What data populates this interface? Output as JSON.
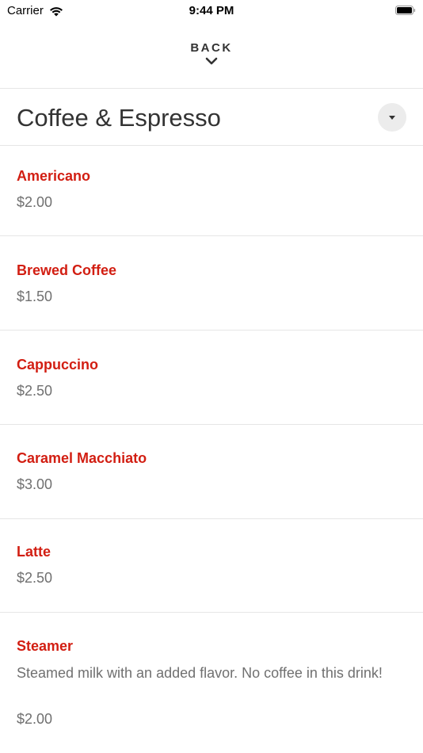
{
  "status_bar": {
    "carrier": "Carrier",
    "time": "9:44 PM"
  },
  "header": {
    "back_label": "BACK"
  },
  "category": {
    "title": "Coffee & Espresso"
  },
  "items": [
    {
      "name": "Americano",
      "price": "$2.00"
    },
    {
      "name": "Brewed Coffee",
      "price": "$1.50"
    },
    {
      "name": "Cappuccino",
      "price": "$2.50"
    },
    {
      "name": "Caramel Macchiato",
      "price": "$3.00"
    },
    {
      "name": "Latte",
      "price": "$2.50"
    },
    {
      "name": "Steamer",
      "description": "Steamed milk with an added flavor. No coffee in this drink!",
      "price": "$2.00"
    }
  ],
  "colors": {
    "item_name": "#d21e12",
    "price": "#707070",
    "divider": "#e6e6e6"
  }
}
